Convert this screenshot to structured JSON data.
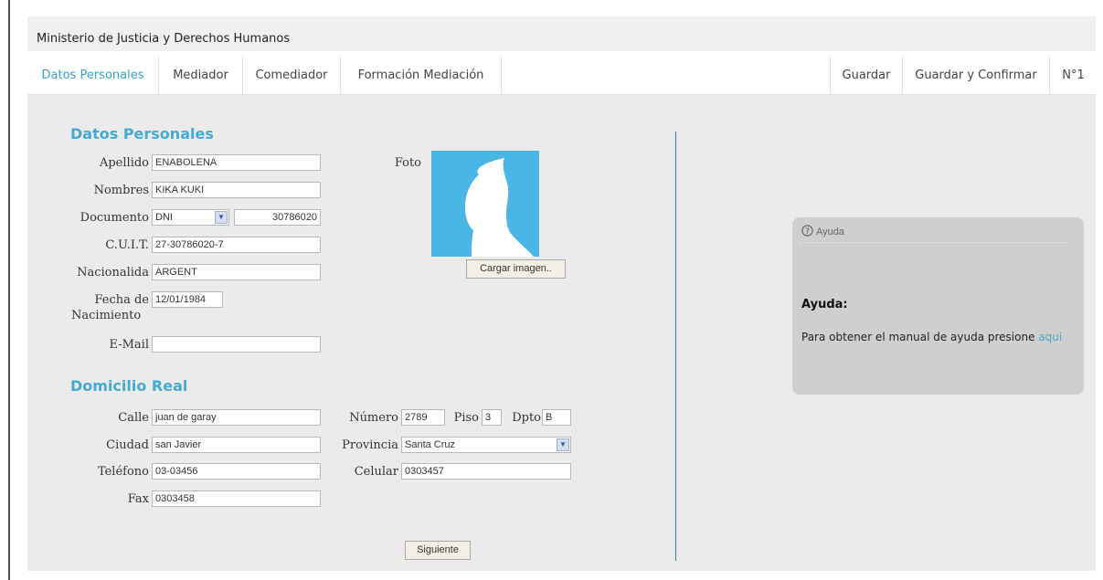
{
  "header": {
    "title": "Ministerio de Justicia y Derechos Humanos"
  },
  "nav": {
    "tabs": [
      "Datos Personales",
      "Mediador",
      "Comediador",
      "Formación Mediación"
    ],
    "actions": [
      "Guardar",
      "Guardar y Confirmar",
      "N°1"
    ]
  },
  "datos": {
    "title": "Datos Personales",
    "apellido_label": "Apellido",
    "apellido_value": "ENABOLENA",
    "nombres_label": "Nombres",
    "nombres_value": "KIKA KUKI",
    "documento_label": "Documento",
    "documento_tipo": "DNI",
    "documento_numero": "30786020",
    "cuit_label": "C.U.I.T.",
    "cuit_value": "27-30786020-7",
    "nacionalidad_label": "Nacionalida",
    "nacionalidad_value": "ARGENT",
    "fecha_label_1": "Fecha de",
    "fecha_label_2": "Nacimiento",
    "fecha_value": "12/01/1984",
    "email_label": "E-Mail",
    "email_value": "",
    "foto_label": "Foto",
    "cargar_button": "Cargar imagen.."
  },
  "domicilio": {
    "title": "Domicilio Real",
    "calle_label": "Calle",
    "calle_value": "juan de garay",
    "numero_label": "Número",
    "numero_value": "2789",
    "piso_label": "Piso",
    "piso_value": "3",
    "dpto_label": "Dpto",
    "dpto_value": "B",
    "ciudad_label": "Ciudad",
    "ciudad_value": "san Javier",
    "provincia_label": "Provincia",
    "provincia_value": "Santa Cruz",
    "telefono_label": "Teléfono",
    "telefono_value": "03-03456",
    "celular_label": "Celular",
    "celular_value": "0303457",
    "fax_label": "Fax",
    "fax_value": "0303458"
  },
  "siguiente_button": "Siguiente",
  "help": {
    "header": "Ayuda",
    "header_icon": "question-icon",
    "title": "Ayuda:",
    "text": "Para obtener el manual de ayuda presione",
    "link": "aqui"
  },
  "colors": {
    "accent": "#47a9cf",
    "photo_bg": "#4bb6e6",
    "divider": "#2d7fb5"
  }
}
